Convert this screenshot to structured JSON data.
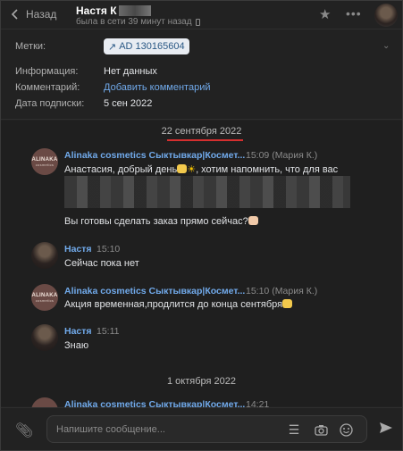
{
  "header": {
    "back_label": "Назад",
    "name": "Настя К",
    "status": "была в сети 39 минут назад"
  },
  "info": {
    "tags_label": "Метки:",
    "tag_value": "AD 130165604",
    "information_label": "Информация:",
    "information_value": "Нет данных",
    "comment_label": "Комментарий:",
    "comment_link": "Добавить комментарий",
    "subscription_label": "Дата подписки:",
    "subscription_value": "5 сен 2022"
  },
  "messages": {
    "date1": "22 сентября 2022",
    "date2": "1 октября 2022",
    "brand_avatar_text": "ALINAKA",
    "brand_avatar_sub": "cosmetics",
    "m1": {
      "sender": "Alinaka cosmetics Сыктывкар|Космет...",
      "time": "15:09 (Мария К.)",
      "line1": "Анастасия, добрый день",
      "line1_tail": ", хотим напомнить, что для вас",
      "line3": "Вы готовы сделать заказ прямо сейчас?"
    },
    "m2": {
      "sender": "Настя",
      "time": "15:10",
      "text": "Сейчас пока нет"
    },
    "m3": {
      "sender": "Alinaka cosmetics Сыктывкар|Космет...",
      "time": "15:10 (Мария К.)",
      "text": "Акция временная,продлится до конца сентября"
    },
    "m4": {
      "sender": "Настя",
      "time": "15:11",
      "text": "Знаю"
    },
    "m5": {
      "sender": "Alinaka cosmetics Сыктывкар|Космет...",
      "time": "14:21"
    }
  },
  "composer": {
    "placeholder": "Напишите сообщение..."
  }
}
